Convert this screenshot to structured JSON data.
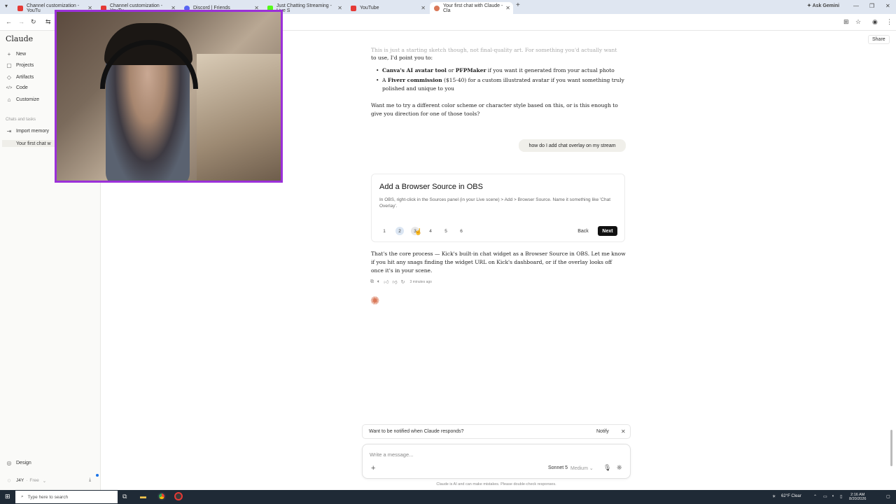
{
  "browser": {
    "tabs": [
      {
        "label": "Channel customization - YouTu",
        "color": "#e53935"
      },
      {
        "label": "Channel customization - YouTu",
        "color": "#e53935"
      },
      {
        "label": "Discord | Friends",
        "color": "#5865f2"
      },
      {
        "label": "Just Chatting Streaming - Live S",
        "color": "#53fc18"
      },
      {
        "label": "YouTube",
        "color": "#e53935"
      },
      {
        "label": "Your first chat with Claude - Cla",
        "color": "#d97757"
      }
    ],
    "ask_gemini": "Ask Gemini"
  },
  "sidebar": {
    "brand": "Claude",
    "items": [
      {
        "label": "New",
        "icon": "+"
      },
      {
        "label": "Projects",
        "icon": "▢"
      },
      {
        "label": "Artifacts",
        "icon": "◇"
      },
      {
        "label": "Code",
        "icon": "</>"
      },
      {
        "label": "Customize",
        "icon": "⌂"
      }
    ],
    "section_label": "Chats and tasks",
    "import": "Import memory",
    "current_chat": "Your first chat w",
    "design": "Design",
    "user": "J4Y",
    "plan": "Free"
  },
  "header": {
    "share": "Share"
  },
  "chat": {
    "faded_line": "This is just a starting sketch though, not final-quality art. For something you'd actually want",
    "line2": "to use, I'd point you to:",
    "bullet1_a": "Canva's AI avatar tool",
    "bullet1_b": " or ",
    "bullet1_c": "PFPMaker",
    "bullet1_d": " if you want it generated from your actual photo",
    "bullet2_a": "A ",
    "bullet2_b": "Fiverr commission",
    "bullet2_c": " ($15-40) for a custom illustrated avatar if you want something truly",
    "bullet2_d": "polished and unique to you",
    "question1": "Want me to try a different color scheme or character style based on this, or is this enough to",
    "question2": "give you direction for one of those tools?",
    "user_message": "how do I add chat overlay on my stream",
    "card": {
      "title": "Add a Browser Source in OBS",
      "body": "In OBS, right-click in the Sources panel (in your Live scene) > Add > Browser Source. Name it something like 'Chat Overlay'.",
      "steps": [
        "1",
        "2",
        "3",
        "4",
        "5",
        "6"
      ],
      "back": "Back",
      "next": "Next"
    },
    "reply1": "That's the core process — Kick's built-in chat widget as a Browser Source in OBS. Let me know",
    "reply2": "if you hit any snags finding the widget URL on Kick's dashboard, or if the overlay looks off",
    "reply3": "once it's in your scene.",
    "timestamp": "3 minutes ago"
  },
  "notify_bar": {
    "text": "Want to be notified when Claude responds?",
    "button": "Notify"
  },
  "composer": {
    "placeholder": "Write a message...",
    "model": "Sonnet 5",
    "effort": "Medium"
  },
  "disclaimer": "Claude is AI and can make mistakes. Please double-check responses.",
  "taskbar": {
    "search": "Type here to search",
    "weather": "62°F  Clear",
    "time": "2:16 AM",
    "date": "8/20/2026"
  }
}
